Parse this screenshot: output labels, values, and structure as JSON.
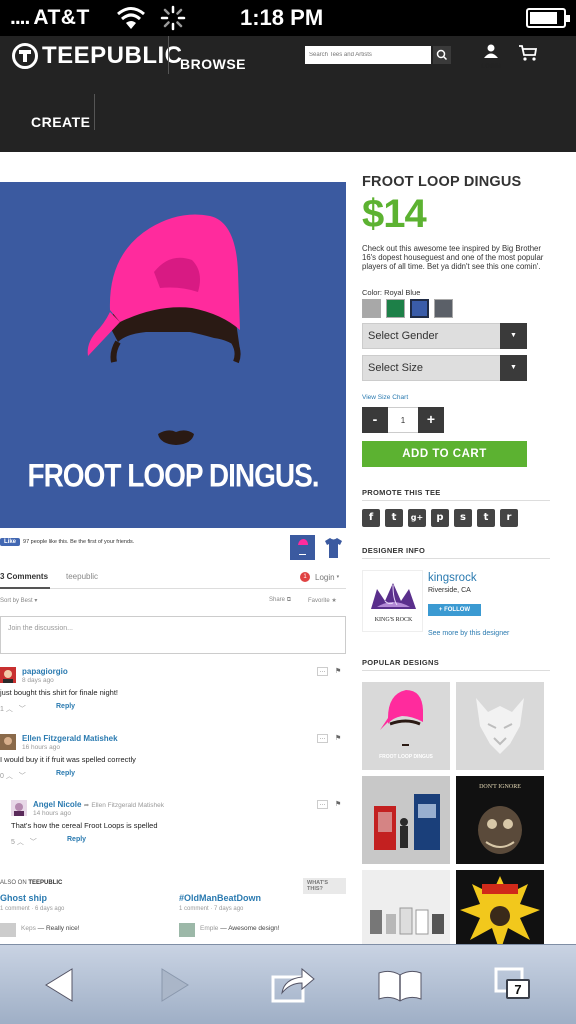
{
  "status_bar": {
    "signal": "....",
    "carrier": "AT&T",
    "time": "1:18 PM",
    "battery_level": 0.85
  },
  "header": {
    "logo_text": "TEEPUBLIC",
    "nav": {
      "browse": "BROWSE",
      "create": "CREATE"
    },
    "search_placeholder": "Search Tees and Artists",
    "login_label": "LOGIN",
    "icons": [
      "teepublic-logo-icon",
      "search-icon",
      "user-icon",
      "cart-icon"
    ]
  },
  "product": {
    "image_text": "FROOT LOOP DINGUS.",
    "image_background": "#3b5aa0",
    "hat_color": "#ff2b9d",
    "title": "FROOT LOOP DINGUS",
    "price": "$14",
    "description": "Check out this awesome tee inspired by Big Brother 16's dopest houseguest and one of the most popular players of all time. Bet ya didn't see this one comin'.",
    "color_label": "Color: Royal Blue",
    "swatches": [
      {
        "name": "Gray",
        "hex": "#a8a8a8"
      },
      {
        "name": "Green",
        "hex": "#1d8048"
      },
      {
        "name": "Royal Blue",
        "hex": "#3a5ca8",
        "selected": true
      },
      {
        "name": "Charcoal",
        "hex": "#5b6068"
      }
    ],
    "gender_select": "Select Gender",
    "size_select": "Select Size",
    "size_chart_link": "View Size Chart",
    "quantity": "1",
    "minus_label": "-",
    "plus_label": "+",
    "add_to_cart": "ADD TO CART"
  },
  "facebook": {
    "like_label": "Like",
    "text": "97 people like this. Be the first of your friends."
  },
  "promote": {
    "heading": "PROMOTE THIS TEE",
    "icons": [
      "facebook-icon",
      "twitter-icon",
      "google-plus-icon",
      "pinterest-icon",
      "stumbleupon-icon",
      "tumblr-icon",
      "reddit-icon"
    ]
  },
  "designer": {
    "heading": "DESIGNER INFO",
    "logo_text": "KING'S ROCK",
    "name": "kingsrock",
    "location": "Riverside, CA",
    "follow_label": "+ FOLLOW",
    "see_more": "See more by this designer"
  },
  "popular": {
    "heading": "POPULAR DESIGNS",
    "designs": [
      {
        "name": "froot-loop-dingus",
        "bg": "#d9d9d9",
        "text": "FROOT LOOP DINGUS"
      },
      {
        "name": "white-wolf",
        "bg": "#d9d9d9"
      },
      {
        "name": "phone-box-police-box",
        "bg": "#c8c8c8"
      },
      {
        "name": "dont-ignore",
        "bg": "#111111",
        "text": "DON'T IGNORE"
      },
      {
        "name": "robots-lineup",
        "bg": "#eeeeee"
      },
      {
        "name": "yellow-comic-burst",
        "bg": "#111111"
      }
    ]
  },
  "comments": {
    "count_label": "3 Comments",
    "site_label": "teepublic",
    "notif_count": "1",
    "login_label": "Login",
    "sort_label": "Sort by Best",
    "share_label": "Share",
    "favorite_label": "Favorite",
    "placeholder": "Join the discussion...",
    "items": [
      {
        "author": "papagiorgio",
        "time": "8 days ago",
        "text": "just bought this shirt for finale night!",
        "votes": "1",
        "reply": "Reply",
        "reply_to": ""
      },
      {
        "author": "Ellen Fitzgerald Matishek",
        "time": "16 hours ago",
        "text": "I would buy it if fruit was spelled correctly",
        "votes": "0",
        "reply": "Reply",
        "reply_to": ""
      },
      {
        "author": "Angel Nicole",
        "reply_to": "Ellen Fitzgerald Matishek",
        "time": "14 hours ago",
        "text": "That's how the cereal Froot Loops is spelled",
        "votes": "5",
        "reply": "Reply"
      }
    ]
  },
  "also_on": {
    "label_prefix": "ALSO ON",
    "site": "TEEPUBLIC",
    "whats_this": "WHAT'S THIS?",
    "discussions": [
      {
        "title": "Ghost ship",
        "meta": "1 comment · 6 days ago",
        "who": "Keps",
        "snippet": "Really nice!"
      },
      {
        "title": "#OldManBeatDown",
        "meta": "1 comment · 7 days ago",
        "who": "Emple",
        "snippet": "Awesome design!"
      }
    ]
  },
  "toolbar": {
    "tab_count": "7",
    "icons": [
      "back-icon",
      "forward-icon",
      "share-icon",
      "bookmarks-icon",
      "tabs-icon"
    ]
  }
}
